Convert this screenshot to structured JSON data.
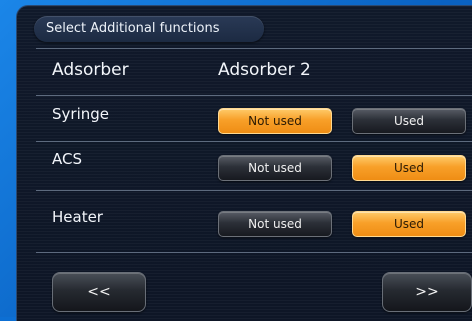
{
  "title": "Select Additional functions",
  "rows": {
    "adsorber": {
      "label": "Adsorber",
      "value": "Adsorber 2"
    },
    "syringe": {
      "label": "Syringe",
      "not_used": "Not used",
      "used": "Used",
      "selected": "Not used"
    },
    "acs": {
      "label": "ACS",
      "not_used": "Not used",
      "used": "Used",
      "selected": "Used"
    },
    "heater": {
      "label": "Heater",
      "not_used": "Not used",
      "used": "Used",
      "selected": "Used"
    }
  },
  "nav": {
    "back": "<<",
    "forward": ">>"
  },
  "colors": {
    "selected": "#f8a029",
    "unselected": "#2c3038",
    "background": "#0e1626",
    "frame": "#0d6fd3"
  }
}
